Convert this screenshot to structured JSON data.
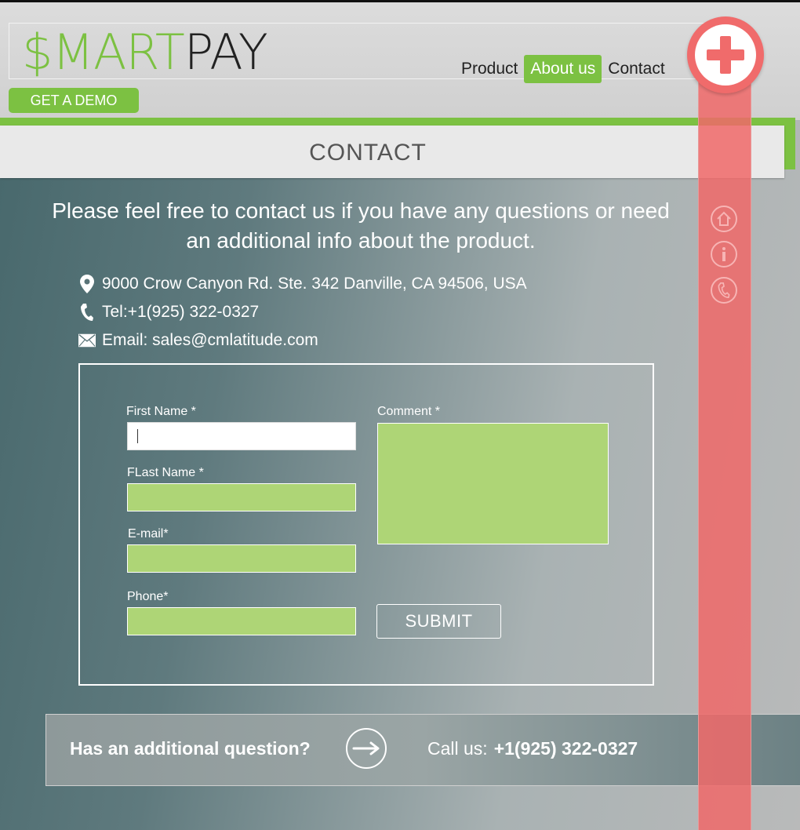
{
  "header": {
    "logo": {
      "part1": "$MART",
      "part2": "PAY"
    },
    "nav": [
      {
        "label": "Product"
      },
      {
        "label": "About us"
      },
      {
        "label": "Contact"
      }
    ],
    "demo_button": "GET A DEMO"
  },
  "page_title": "CONTACT",
  "intro": "Please feel free to contact us if you have any questions or need an additional info about the product.",
  "contact_info": {
    "address": "9000 Crow Canyon Rd. Ste. 342   Danville, CA 94506, USA",
    "phone": "Tel:+1(925) 322-0327",
    "email": "Email: sales@cmlatitude.com"
  },
  "form": {
    "first_name_label": "First Name *",
    "last_name_label": "FLast Name *",
    "email_label": "E-mail*",
    "phone_label": "Phone*",
    "comment_label": "Comment *",
    "submit_label": "SUBMIT"
  },
  "cta": {
    "question": "Has an additional question?",
    "call_label": "Call us:",
    "call_number": "+1(925) 322-0327"
  },
  "colors": {
    "accent": "#7cc142",
    "input_fill": "#aed576",
    "side_panel": "#f06b6b"
  },
  "icons": [
    "map-pin-icon",
    "phone-icon",
    "envelope-icon",
    "arrow-right-icon",
    "plus-icon",
    "home-icon",
    "info-icon",
    "phone-side-icon"
  ]
}
